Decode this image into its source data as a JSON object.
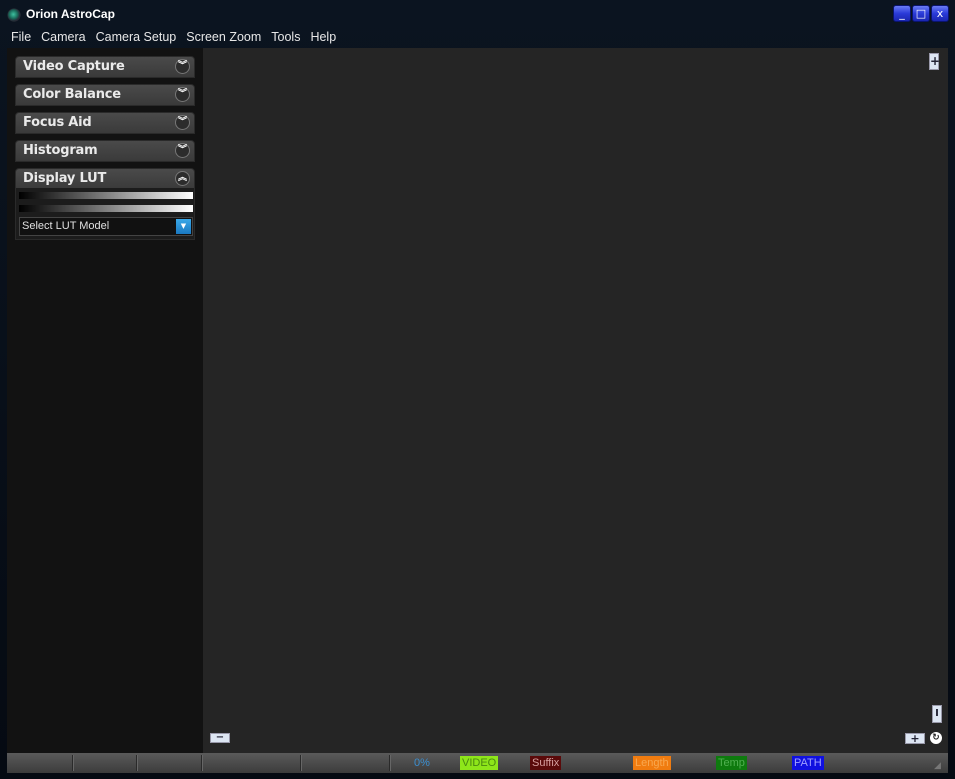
{
  "window": {
    "title": "Orion AstroCap",
    "controls": {
      "minimize": "_",
      "maximize": "□",
      "close": "x"
    }
  },
  "menu": [
    "File",
    "Camera",
    "Camera Setup",
    "Screen Zoom",
    "Tools",
    "Help"
  ],
  "sidebar": {
    "panels": [
      {
        "label": "Video Capture",
        "state": "collapsed",
        "icon": "double-chevron-down"
      },
      {
        "label": "Color Balance",
        "state": "collapsed",
        "icon": "double-chevron-down"
      },
      {
        "label": "Focus Aid",
        "state": "collapsed",
        "icon": "double-chevron-down"
      },
      {
        "label": "Histogram",
        "state": "collapsed",
        "icon": "double-chevron-down"
      },
      {
        "label": "Display LUT",
        "state": "expanded",
        "icon": "double-chevron-up"
      }
    ],
    "lut": {
      "select_value": "Select LUT Model"
    }
  },
  "viewer": {
    "zoom_in_icon": "+",
    "zoom_out_icon": "−",
    "vertical_icon": "I",
    "add_icon": "+",
    "rotate_icon": "↻"
  },
  "statusbar": {
    "progress": "0%",
    "video": "VIDEO",
    "suffix": "Suffix",
    "length": "Length",
    "temp": "Temp",
    "path": "PATH",
    "colors": {
      "progress": "#3a8ed0",
      "video_bg": "#8ee61a",
      "suffix_bg": "#5a0a0a",
      "length_bg": "#f07c10",
      "temp_bg": "#0e7a0e",
      "path_bg": "#1010e0"
    }
  }
}
